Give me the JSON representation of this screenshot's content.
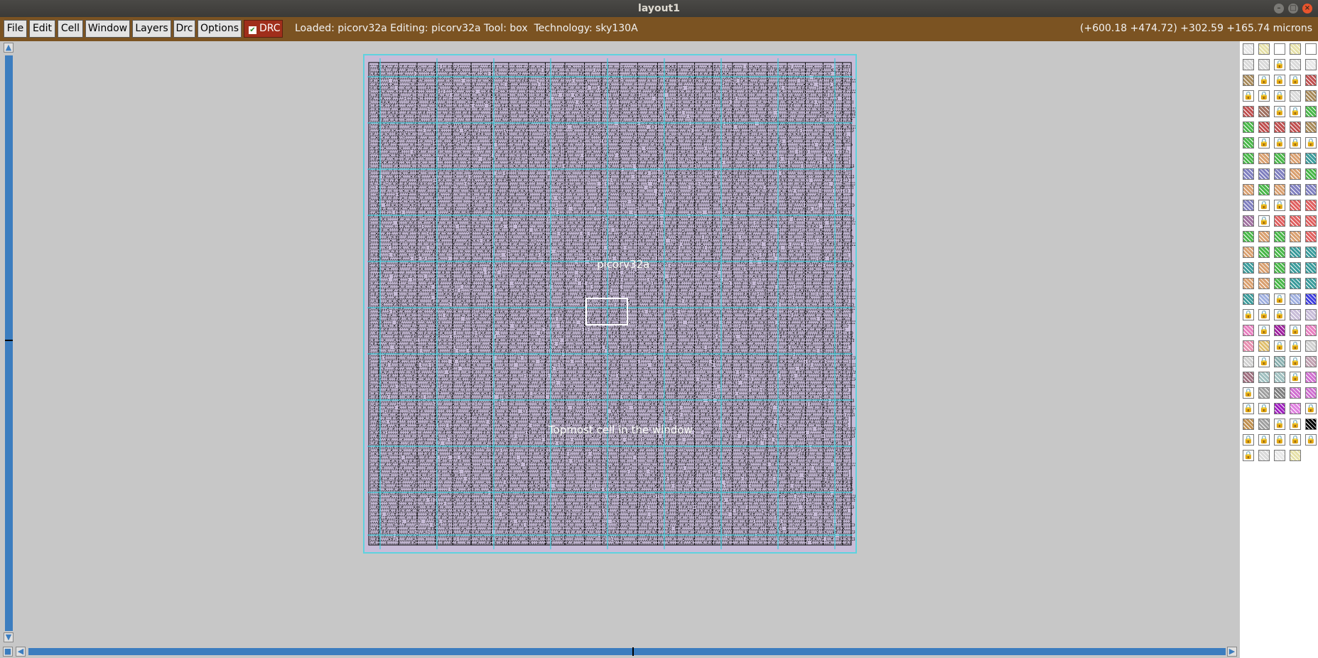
{
  "window": {
    "title": "layout1"
  },
  "menu": {
    "items": [
      {
        "label": "File"
      },
      {
        "label": "Edit"
      },
      {
        "label": "Cell"
      },
      {
        "label": "Window"
      },
      {
        "label": "Layers"
      },
      {
        "label": "Drc"
      },
      {
        "label": "Options"
      }
    ],
    "drc_label": "DRC",
    "drc_checked": true
  },
  "status": {
    "text": "Loaded: picorv32a Editing: picorv32a Tool: box  Technology: sky130A",
    "coords": "(+600.18 +474.72) +302.59 +165.74 microns"
  },
  "layout": {
    "cell_name": "picorv32a",
    "top_label": "Topmost cell in the window"
  },
  "colors": {
    "menubar": "#7b5322",
    "scrollbar": "#3c7dbf",
    "canvas": "#c7c7c7",
    "die_fill": "#c8bcd8",
    "die_border": "#5fd2de",
    "drc_button": "#a02e1b"
  },
  "palette": {
    "swatches": [
      "#e8e8e8",
      "#e6e1a8",
      "#ffffff",
      "#e6e1a8",
      "#ffffff",
      "#d9d9d9",
      "#d9d9d9",
      "lock",
      "#d9d9d9",
      "#e8e8e8",
      "#a88a5a",
      "lock",
      "lock",
      "lock",
      "#c05050",
      "lock",
      "lock",
      "lock",
      "#d9d9d9",
      "#a88a5a",
      "#c05050",
      "#a07060",
      "lock",
      "lock",
      "#4ab84a",
      "#4ab84a",
      "#c05050",
      "#c05050",
      "#c05050",
      "#a88a5a",
      "#4ab84a",
      "lock",
      "lock",
      "lock",
      "lock",
      "#4ab84a",
      "#d9a070",
      "#4ab84a",
      "#d9a070",
      "#3c9c9c",
      "#8080c0",
      "#8080c0",
      "#8080c0",
      "#d9a070",
      "#4ab84a",
      "#d9a070",
      "#4ab84a",
      "#d9a070",
      "#8080c0",
      "#8080c0",
      "#8080c0",
      "lock",
      "lock",
      "#e06060",
      "#e06060",
      "#a070a0",
      "lock",
      "#e06060",
      "#e06060",
      "#e06060",
      "#4ab84a",
      "#d9a070",
      "#4ab84a",
      "#d9a070",
      "#e06060",
      "#d9a070",
      "#4ab84a",
      "#4ab84a",
      "#3c9c9c",
      "#3c9c9c",
      "#3c9c9c",
      "#d9a070",
      "#4ab84a",
      "#3c9c9c",
      "#3c9c9c",
      "#d9a070",
      "#d9a070",
      "#4ab84a",
      "#3c9c9c",
      "#3c9c9c",
      "#3c9c9c",
      "#a0b0e0",
      "lock",
      "#a0b0e0",
      "#4040e0",
      "lock",
      "lock",
      "lock",
      "#c8bcd8",
      "#c8bcd8",
      "#e880c0",
      "lock",
      "#a020a0",
      "lock",
      "#e880c0",
      "#e890b0",
      "#e0c070",
      "lock",
      "lock",
      "#d0d0d0",
      "#d0d0d0",
      "lock",
      "#8ab0b0",
      "lock",
      "#c0a0b0",
      "#a07080",
      "#a0c0c0",
      "#a0c0c0",
      "lock",
      "#d070d0",
      "lock",
      "#a0a0a0",
      "#808080",
      "#d070d0",
      "#d070d0",
      "lock",
      "lock",
      "#a020c0",
      "#e080e0",
      "lock",
      "#c09050",
      "#a0a0a0",
      "lock",
      "lock",
      "#000000",
      "lock",
      "lock",
      "lock",
      "lock",
      "lock",
      "lock",
      "#d9d9d9",
      "#e8e8e8",
      "#e6e1a8",
      "none"
    ]
  }
}
